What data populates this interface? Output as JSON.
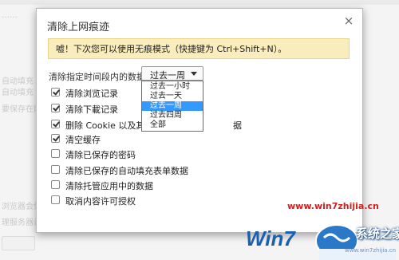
{
  "dialog": {
    "title": "清除上网痕迹",
    "close_glyph": "×",
    "banner": "嘘！下次您可以使用无痕模式（快捷键为 Ctrl+Shift+N）。",
    "time_range_label": "清除指定时间段内的数据：",
    "time_range_selected": "过去一周",
    "time_range_options": [
      "过去一小时",
      "过去一天",
      "过去一周",
      "过去四周",
      "全部"
    ],
    "options": [
      {
        "label": "清除浏览记录",
        "checked": true
      },
      {
        "label": "清除下載记录",
        "checked": true
      },
      {
        "label": "删除 Cookie 以及其他",
        "label_tail": "据",
        "checked": true
      },
      {
        "label": "清空缓存",
        "checked": true
      },
      {
        "label": "清除已保存的密码",
        "checked": false
      },
      {
        "label": "清除已保存的自动填充表单数据",
        "checked": false
      },
      {
        "label": "清除托管应用中的数据",
        "checked": false
      },
      {
        "label": "取消内容许可授权",
        "checked": false
      }
    ]
  },
  "background": {
    "lines": [
      "自动填充",
      "自动填充",
      "要保存在网",
      "浏览器会使",
      "理服务器设"
    ]
  },
  "watermark": {
    "url": "www.win7zhijia.cn",
    "logo_text": "系统之家"
  }
}
